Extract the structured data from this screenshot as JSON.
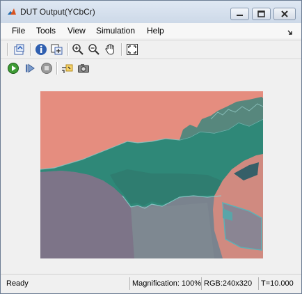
{
  "window": {
    "title": "DUT Output(YCbCr)"
  },
  "menu": {
    "items": [
      "File",
      "Tools",
      "View",
      "Simulation",
      "Help"
    ]
  },
  "toolbar": {
    "row1_icons": [
      "print-to-figure-icon",
      "info-icon",
      "maintain-fit-icon",
      "zoom-in-icon",
      "zoom-out-icon",
      "pan-hand-icon",
      "fit-to-view-icon"
    ],
    "row2_icons": [
      "run-icon",
      "step-forward-icon",
      "stop-icon",
      "highlight-signal-icon",
      "snapshot-camera-icon"
    ]
  },
  "image": {
    "description_colors": {
      "sky": "#e58d7f",
      "foliage": "#2f8878",
      "road": "#7b8591",
      "car": "#d08a80"
    }
  },
  "status": {
    "ready": "Ready",
    "magnification": "Magnification: 100%",
    "rgb": "RGB:240x320",
    "time": "T=10.000"
  }
}
